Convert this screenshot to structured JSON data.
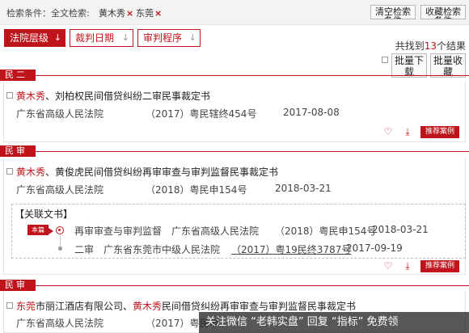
{
  "search": {
    "condition_label": "检索条件：全文检索:",
    "chips": [
      {
        "label": "黄木秀",
        "remove": "×"
      },
      {
        "label": "东莞",
        "remove": "×"
      }
    ],
    "clear_button": "清空检索条件",
    "save_button": "收藏检索条件"
  },
  "sort": [
    {
      "label": "法院层级",
      "arrow": "↓",
      "active": true
    },
    {
      "label": "裁判日期",
      "arrow": "↓",
      "active": false
    },
    {
      "label": "审判程序",
      "arrow": "↓",
      "active": false
    }
  ],
  "results": {
    "prefix": "共找到",
    "count": "13",
    "suffix": "个结果"
  },
  "bulk": {
    "download": "批量下载",
    "favorite": "批量收藏"
  },
  "cases": [
    {
      "section": "民二",
      "title_parts": [
        {
          "text": "黄木秀",
          "hl": true
        },
        {
          "text": "、刘柏权民间借贷纠纷二审民事裁定书",
          "hl": false
        }
      ],
      "court": "广东省高级人民法院",
      "case_no": "（2017）粤民辖终454号",
      "date": "2017-08-08",
      "recommend": "推荐案例"
    },
    {
      "section": "民审",
      "title_parts": [
        {
          "text": "黄木秀",
          "hl": true
        },
        {
          "text": "、黄俊虎民间借贷纠纷再审审查与审判监督民事裁定书",
          "hl": false
        }
      ],
      "court": "广东省高级人民法院",
      "case_no": "（2018）粤民申154号",
      "date": "2018-03-21",
      "related_label": "【关联文书】",
      "current_tag": "本篇",
      "related": [
        {
          "stage": "再审审查与审判监督",
          "court": "广东省高级人民法院",
          "case_no": "（2018）粤民申154号",
          "date": "2018-03-21"
        },
        {
          "stage": "二审",
          "court": "广东省东莞市中级人民法院",
          "case_no": "（2017）粤19民终3787号",
          "date": "2017-09-19"
        }
      ],
      "recommend": "推荐案例"
    },
    {
      "section": "民审",
      "title_parts": [
        {
          "text": "东莞",
          "hl": true
        },
        {
          "text": "市丽江酒店有限公司、",
          "hl": false
        },
        {
          "text": "黄木秀",
          "hl": true
        },
        {
          "text": "民间借贷纠纷再审审查与审判监督民事裁定书",
          "hl": false
        }
      ],
      "court": "广东省高级人民法院",
      "case_no": "（2017）粤民申",
      "date": ""
    }
  ],
  "watermark": "关注微信 “老韩实盘” 回复 “指标” 免费领",
  "colors": {
    "accent": "#c0141c",
    "border": "#e4e4e4",
    "bar": "#f3f3f3"
  },
  "icons": [
    "heart-icon",
    "download-icon",
    "checkbox-icon",
    "close-icon",
    "arrow-down-icon",
    "radio-current-icon"
  ]
}
